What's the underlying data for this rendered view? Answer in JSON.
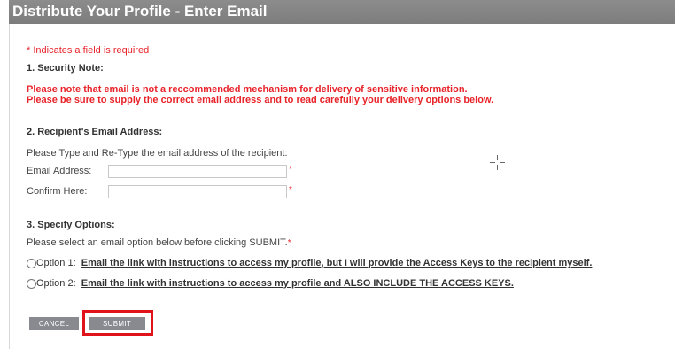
{
  "header": {
    "title": "Distribute Your Profile - Enter Email"
  },
  "required_note": "* Indicates a field is required",
  "security": {
    "heading": "1. Security Note:",
    "line1": "Please note that email is not a reccommended mechanism for delivery of sensitive information.",
    "line2": "Please be sure to supply the correct email address and to read carefully your delivery options below."
  },
  "recipient": {
    "heading": "2. Recipient's Email Address:",
    "instruction": "Please Type and Re-Type the email address of the recipient:",
    "email_label": "Email Address:",
    "email_value": "",
    "confirm_label": "Confirm Here:",
    "confirm_value": "",
    "required_marker": "*"
  },
  "options": {
    "heading": "3. Specify Options:",
    "instruction": "Please select an email option below before clicking SUBMIT.",
    "required_marker": "*",
    "option1_label": "Option 1:",
    "option1_text": "Email the link with instructions to access my profile, but I will provide the Access Keys to the recipient myself.",
    "option2_label": "Option 2:",
    "option2_text": "Email the link with instructions to access my profile and ALSO INCLUDE THE ACCESS KEYS."
  },
  "buttons": {
    "cancel": "CANCEL",
    "submit": "SUBMIT"
  },
  "colors": {
    "header_bg": "#858585",
    "required_red": "#e8232a",
    "button_gray": "#888a8f",
    "highlight_red": "#e0121a"
  },
  "icons": {
    "cursor": "crosshair-cursor-icon"
  }
}
